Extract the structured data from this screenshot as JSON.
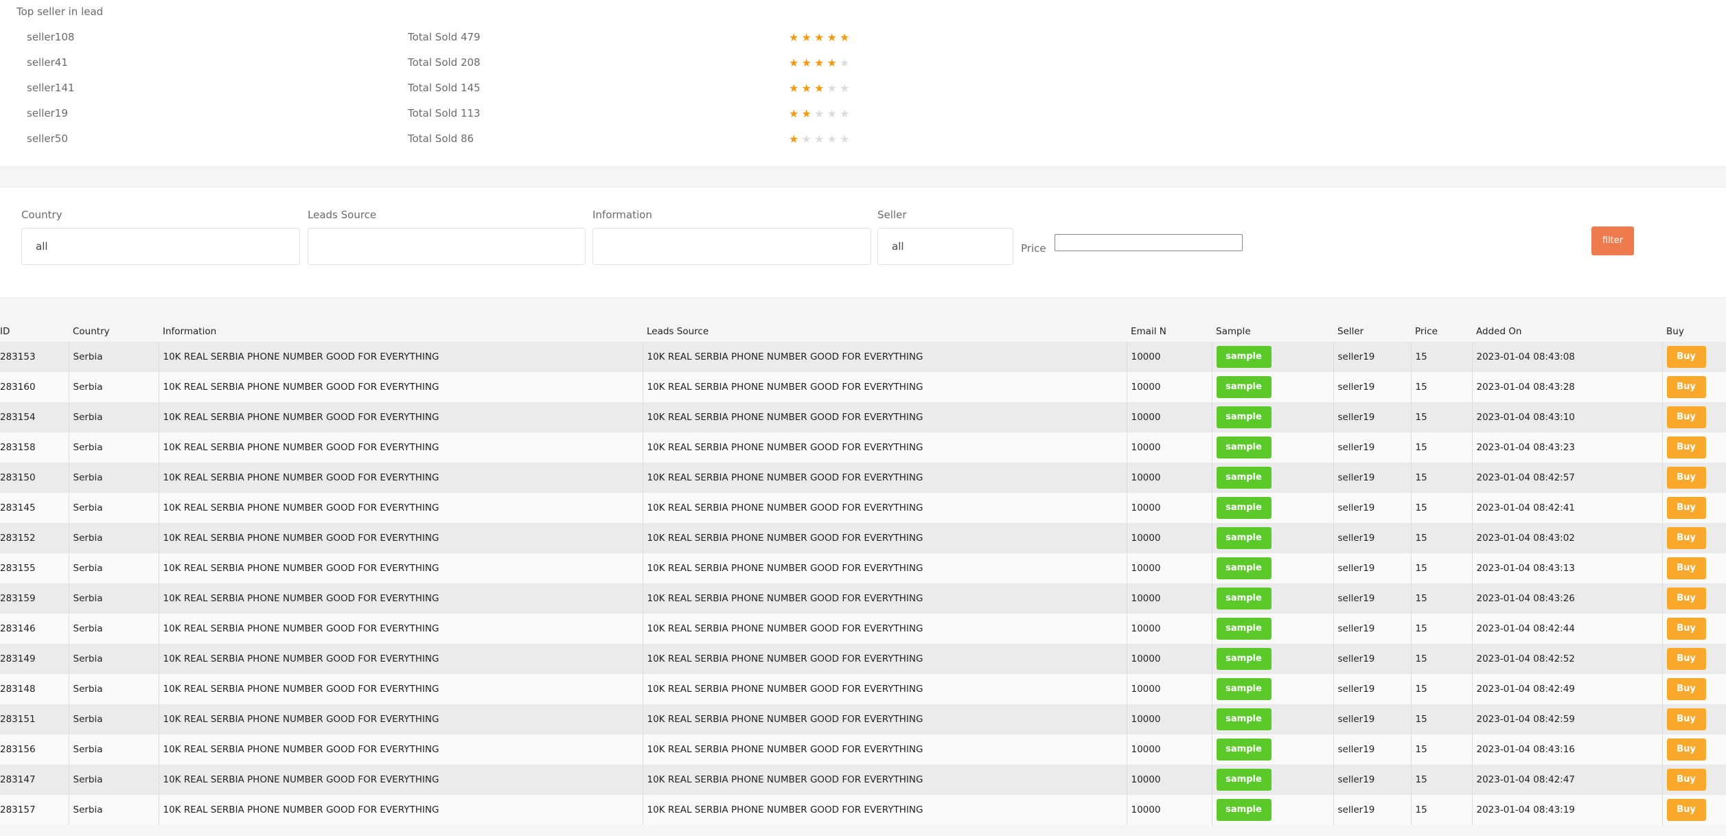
{
  "top_sellers": {
    "title": "Top seller in lead",
    "rows": [
      {
        "name": "seller108",
        "sold": "Total Sold 479",
        "rating": 5
      },
      {
        "name": "seller41",
        "sold": "Total Sold 208",
        "rating": 4
      },
      {
        "name": "seller141",
        "sold": "Total Sold 145",
        "rating": 3
      },
      {
        "name": "seller19",
        "sold": "Total Sold 113",
        "rating": 2
      },
      {
        "name": "seller50",
        "sold": "Total Sold 86",
        "rating": 1
      }
    ],
    "max_rating": 5,
    "star_color": "#f39a13"
  },
  "filters": {
    "country_label": "Country",
    "country_value": "all",
    "leads_source_label": "Leads Source",
    "leads_source_value": "",
    "information_label": "Information",
    "information_value": "",
    "seller_label": "Seller",
    "seller_value": "all",
    "price_label": "Price",
    "price_value": "",
    "filter_button": "filter"
  },
  "table": {
    "headers": [
      "ID",
      "Country",
      "Information",
      "Leads Source",
      "Email N",
      "Sample",
      "Seller",
      "Price",
      "Added On",
      "Buy"
    ],
    "sample_label": "sample",
    "buy_label": "Buy",
    "rows": [
      {
        "id": "283153",
        "country": "Serbia",
        "information": "10K REAL SERBIA PHONE NUMBER GOOD FOR EVERYTHING",
        "source": "10K REAL SERBIA PHONE NUMBER GOOD FOR EVERYTHING",
        "email_n": "10000",
        "seller": "seller19",
        "price": "15",
        "added": "2023-01-04 08:43:08"
      },
      {
        "id": "283160",
        "country": "Serbia",
        "information": "10K REAL SERBIA PHONE NUMBER GOOD FOR EVERYTHING",
        "source": "10K REAL SERBIA PHONE NUMBER GOOD FOR EVERYTHING",
        "email_n": "10000",
        "seller": "seller19",
        "price": "15",
        "added": "2023-01-04 08:43:28"
      },
      {
        "id": "283154",
        "country": "Serbia",
        "information": "10K REAL SERBIA PHONE NUMBER GOOD FOR EVERYTHING",
        "source": "10K REAL SERBIA PHONE NUMBER GOOD FOR EVERYTHING",
        "email_n": "10000",
        "seller": "seller19",
        "price": "15",
        "added": "2023-01-04 08:43:10"
      },
      {
        "id": "283158",
        "country": "Serbia",
        "information": "10K REAL SERBIA PHONE NUMBER GOOD FOR EVERYTHING",
        "source": "10K REAL SERBIA PHONE NUMBER GOOD FOR EVERYTHING",
        "email_n": "10000",
        "seller": "seller19",
        "price": "15",
        "added": "2023-01-04 08:43:23"
      },
      {
        "id": "283150",
        "country": "Serbia",
        "information": "10K REAL SERBIA PHONE NUMBER GOOD FOR EVERYTHING",
        "source": "10K REAL SERBIA PHONE NUMBER GOOD FOR EVERYTHING",
        "email_n": "10000",
        "seller": "seller19",
        "price": "15",
        "added": "2023-01-04 08:42:57"
      },
      {
        "id": "283145",
        "country": "Serbia",
        "information": "10K REAL SERBIA PHONE NUMBER GOOD FOR EVERYTHING",
        "source": "10K REAL SERBIA PHONE NUMBER GOOD FOR EVERYTHING",
        "email_n": "10000",
        "seller": "seller19",
        "price": "15",
        "added": "2023-01-04 08:42:41"
      },
      {
        "id": "283152",
        "country": "Serbia",
        "information": "10K REAL SERBIA PHONE NUMBER GOOD FOR EVERYTHING",
        "source": "10K REAL SERBIA PHONE NUMBER GOOD FOR EVERYTHING",
        "email_n": "10000",
        "seller": "seller19",
        "price": "15",
        "added": "2023-01-04 08:43:02"
      },
      {
        "id": "283155",
        "country": "Serbia",
        "information": "10K REAL SERBIA PHONE NUMBER GOOD FOR EVERYTHING",
        "source": "10K REAL SERBIA PHONE NUMBER GOOD FOR EVERYTHING",
        "email_n": "10000",
        "seller": "seller19",
        "price": "15",
        "added": "2023-01-04 08:43:13"
      },
      {
        "id": "283159",
        "country": "Serbia",
        "information": "10K REAL SERBIA PHONE NUMBER GOOD FOR EVERYTHING",
        "source": "10K REAL SERBIA PHONE NUMBER GOOD FOR EVERYTHING",
        "email_n": "10000",
        "seller": "seller19",
        "price": "15",
        "added": "2023-01-04 08:43:26"
      },
      {
        "id": "283146",
        "country": "Serbia",
        "information": "10K REAL SERBIA PHONE NUMBER GOOD FOR EVERYTHING",
        "source": "10K REAL SERBIA PHONE NUMBER GOOD FOR EVERYTHING",
        "email_n": "10000",
        "seller": "seller19",
        "price": "15",
        "added": "2023-01-04 08:42:44"
      },
      {
        "id": "283149",
        "country": "Serbia",
        "information": "10K REAL SERBIA PHONE NUMBER GOOD FOR EVERYTHING",
        "source": "10K REAL SERBIA PHONE NUMBER GOOD FOR EVERYTHING",
        "email_n": "10000",
        "seller": "seller19",
        "price": "15",
        "added": "2023-01-04 08:42:52"
      },
      {
        "id": "283148",
        "country": "Serbia",
        "information": "10K REAL SERBIA PHONE NUMBER GOOD FOR EVERYTHING",
        "source": "10K REAL SERBIA PHONE NUMBER GOOD FOR EVERYTHING",
        "email_n": "10000",
        "seller": "seller19",
        "price": "15",
        "added": "2023-01-04 08:42:49"
      },
      {
        "id": "283151",
        "country": "Serbia",
        "information": "10K REAL SERBIA PHONE NUMBER GOOD FOR EVERYTHING",
        "source": "10K REAL SERBIA PHONE NUMBER GOOD FOR EVERYTHING",
        "email_n": "10000",
        "seller": "seller19",
        "price": "15",
        "added": "2023-01-04 08:42:59"
      },
      {
        "id": "283156",
        "country": "Serbia",
        "information": "10K REAL SERBIA PHONE NUMBER GOOD FOR EVERYTHING",
        "source": "10K REAL SERBIA PHONE NUMBER GOOD FOR EVERYTHING",
        "email_n": "10000",
        "seller": "seller19",
        "price": "15",
        "added": "2023-01-04 08:43:16"
      },
      {
        "id": "283147",
        "country": "Serbia",
        "information": "10K REAL SERBIA PHONE NUMBER GOOD FOR EVERYTHING",
        "source": "10K REAL SERBIA PHONE NUMBER GOOD FOR EVERYTHING",
        "email_n": "10000",
        "seller": "seller19",
        "price": "15",
        "added": "2023-01-04 08:42:47"
      },
      {
        "id": "283157",
        "country": "Serbia",
        "information": "10K REAL SERBIA PHONE NUMBER GOOD FOR EVERYTHING",
        "source": "10K REAL SERBIA PHONE NUMBER GOOD FOR EVERYTHING",
        "email_n": "10000",
        "seller": "seller19",
        "price": "15",
        "added": "2023-01-04 08:43:19"
      }
    ]
  },
  "colors": {
    "sample_button": "#5cc92a",
    "buy_button": "#f8a82b",
    "filter_button": "#ee7b4e"
  }
}
